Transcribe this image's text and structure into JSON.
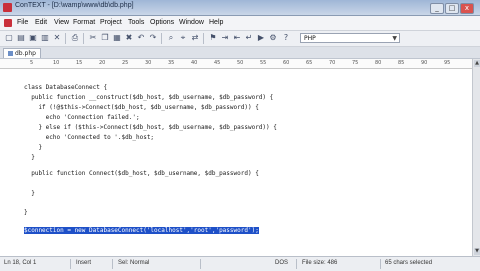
{
  "window": {
    "title": "ConTEXT - [D:\\wamp\\www\\db\\db.php]",
    "controls": [
      "_",
      "□",
      "x"
    ]
  },
  "menu": {
    "items": [
      "File",
      "Edit",
      "View",
      "Format",
      "Project",
      "Tools",
      "Options",
      "Window",
      "Help"
    ]
  },
  "toolbar": {
    "highlighter": "PHP"
  },
  "tabs": [
    {
      "label": "db.php"
    }
  ],
  "ruler": {
    "marks": [
      "5",
      "10",
      "15",
      "20",
      "25",
      "30",
      "35",
      "40",
      "45",
      "50",
      "55",
      "60",
      "65",
      "70",
      "75",
      "80",
      "85",
      "90",
      "95"
    ]
  },
  "editor": {
    "lines": [
      "",
      "class DatabaseConnect {",
      "  public function __construct($db_host, $db_username, $db_password) {",
      "    if (!@$this->Connect($db_host, $db_username, $db_password)) {",
      "      echo 'Connection failed.';",
      "    } else if ($this->Connect($db_host, $db_username, $db_password)) {",
      "      echo 'Connected to '.$db_host;",
      "    }",
      "  }",
      "",
      "  public function Connect($db_host, $db_username, $db_password) {",
      "",
      "  }",
      "",
      "}",
      "",
      "$connection = new DatabaseConnect('localhost','root','password');"
    ],
    "selected_line": 16
  },
  "status": {
    "position": "Ln 18, Col 1",
    "mode": "Insert",
    "selection": "Sel: Normal",
    "line_ending": "DOS",
    "file_size": "File size: 486",
    "selected_chars": "65 chars selected"
  }
}
